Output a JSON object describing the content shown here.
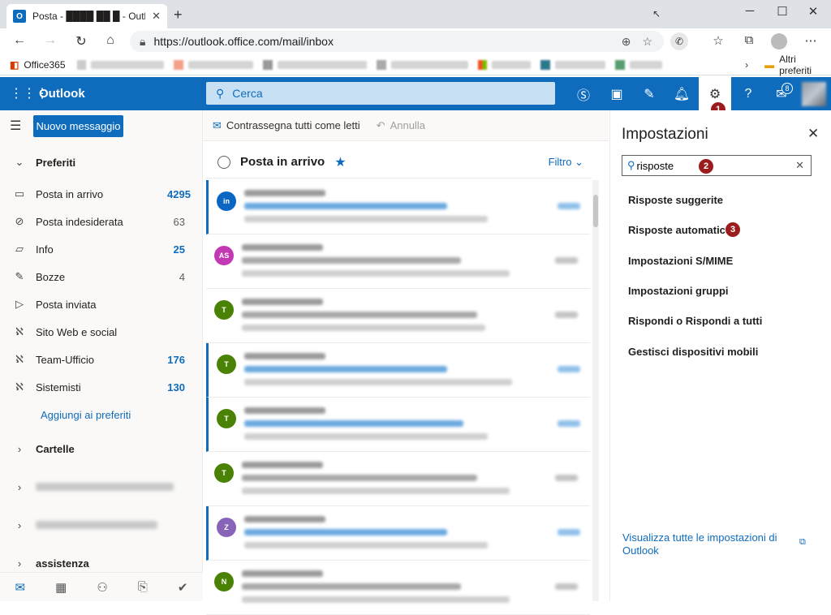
{
  "browser": {
    "tab_title": "Posta - ████ ██ █ - Outlook",
    "url": "https://outlook.office.com/mail/inbox",
    "bookmarks": {
      "first": "Office365",
      "last": "Altri preferiti"
    }
  },
  "outlook": {
    "brand": "Outlook",
    "search_placeholder": "Cerca",
    "notification_count": "8"
  },
  "left": {
    "new_message": "Nuovo messaggio",
    "favorites_label": "Preferiti",
    "folders": [
      {
        "label": "Posta in arrivo",
        "count": "4295"
      },
      {
        "label": "Posta indesiderata",
        "count": "63"
      },
      {
        "label": "Info",
        "count": "25"
      },
      {
        "label": "Bozze",
        "count": "4"
      },
      {
        "label": "Posta inviata",
        "count": ""
      },
      {
        "label": "Sito Web e social",
        "count": ""
      },
      {
        "label": "Team-Ufficio",
        "count": "176"
      },
      {
        "label": "Sistemisti",
        "count": "130"
      }
    ],
    "add_favorites": "Aggiungi ai preferiti",
    "folders_group": "Cartelle",
    "assistenza": "assistenza"
  },
  "middle": {
    "mark_all_read": "Contrassegna tutti come letti",
    "undo": "Annulla",
    "inbox_title": "Posta in arrivo",
    "filter": "Filtro",
    "avatars": [
      "in",
      "AS",
      "T",
      "T",
      "T",
      "T",
      "Z",
      "N"
    ]
  },
  "settings": {
    "title": "Impostazioni",
    "search_value": "risposte",
    "results": [
      "Risposte suggerite",
      "Risposte automatiche",
      "Impostazioni S/MIME",
      "Impostazioni gruppi",
      "Rispondi o Rispondi a tutti",
      "Gestisci dispositivi mobili"
    ],
    "view_all": "Visualizza tutte le impostazioni di Outlook"
  },
  "callouts": [
    "1",
    "2",
    "3"
  ],
  "colors": {
    "accent": "#0f6cbd",
    "callout": "#9b1c1c"
  }
}
